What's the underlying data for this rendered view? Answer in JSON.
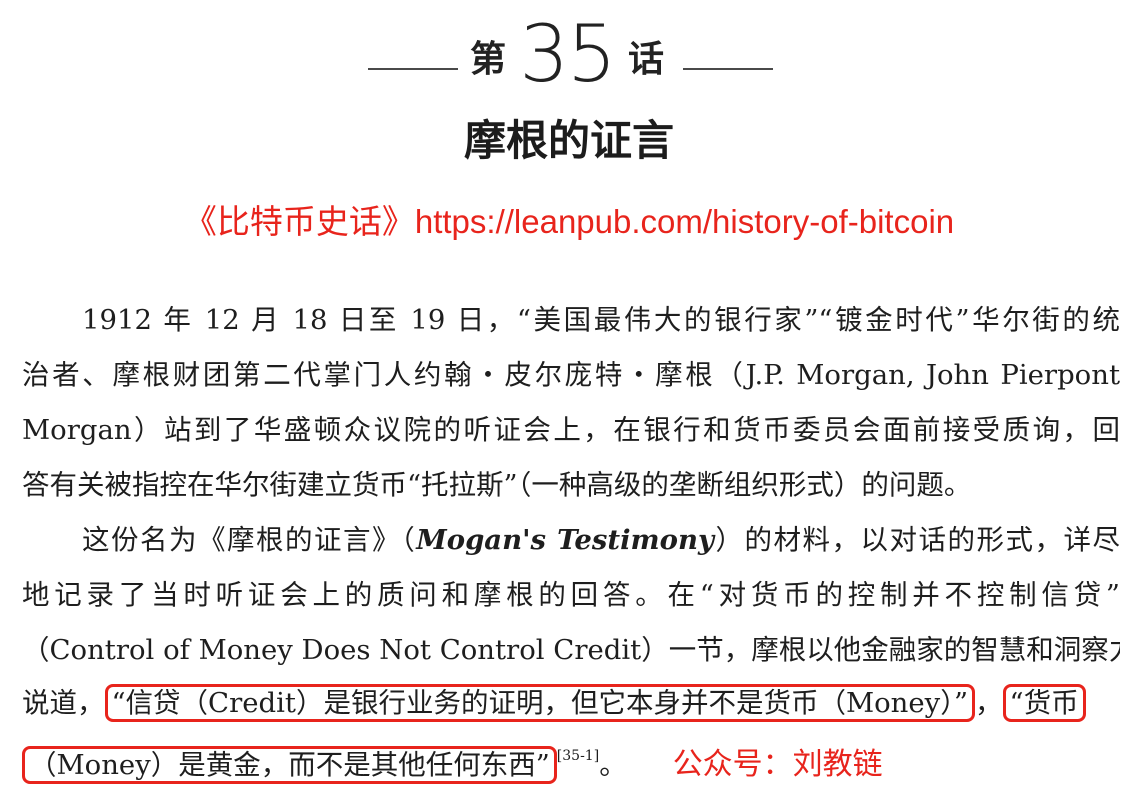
{
  "chapter": {
    "prefix": "第",
    "number": "35",
    "suffix": "话",
    "title": "摩根的证言"
  },
  "watermark": {
    "link_text": "《比特币史话》https://leanpub.com/history-of-bitcoin",
    "color": "#e8241c"
  },
  "paragraph1": {
    "l1": "1912 年 12 月 18 日至 19 日，“美国最伟大的银行家”“镀金时代”华尔街的统",
    "l2": "治者、摩根财团第二代掌门人约翰・皮尔庞特・摩根（J.P. Morgan, John Pierpont",
    "l3": "Morgan）站到了华盛顿众议院的听证会上，在银行和货币委员会面前接受质询，回",
    "l4": "答有关被指控在华尔街建立货币“托拉斯”（一种高级的垄断组织形式）的问题。"
  },
  "paragraph2": {
    "l1_a": "这份名为《摩根的证言》（",
    "l1_italic": "Mogan's Testimony",
    "l1_b": "）的材料，以对话的形式，详尽",
    "l2": "地记录了当时听证会上的质问和摩根的回答。在“对货币的控制并不控制信贷”",
    "l3": "（Control of Money Does Not Control Credit）一节，摩根以他金融家的智慧和洞察力",
    "l4_a": "说道，",
    "quote1": "“信贷（Credit）是银行业务的证明，但它本身并不是货币（Money）”",
    "l4_comma": "，",
    "quote2_part1": "“货币",
    "quote2_part2": "（Money）是黄金，而不是其他任何东西”",
    "ref": "[35-1]",
    "end": "。",
    "wechat": "公众号：刘教链"
  }
}
